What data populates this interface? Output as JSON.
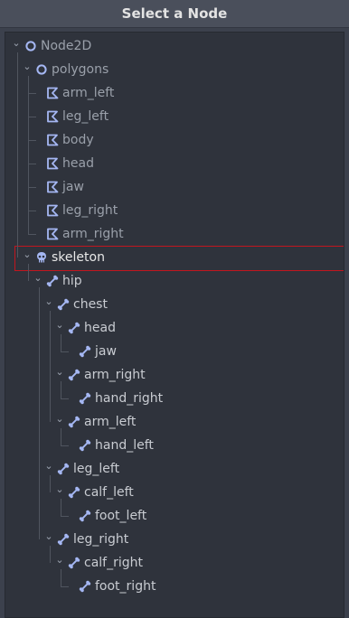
{
  "dialog": {
    "title": "Select a Node"
  },
  "tree": [
    {
      "label": "Node2D",
      "icon": "node2d-icon",
      "depth": 0,
      "expanded": true,
      "dim": true
    },
    {
      "label": "polygons",
      "icon": "node2d-icon",
      "depth": 1,
      "expanded": true,
      "dim": true
    },
    {
      "label": "arm_left",
      "icon": "polygon2d-icon",
      "depth": 2,
      "dim": true
    },
    {
      "label": "leg_left",
      "icon": "polygon2d-icon",
      "depth": 2,
      "dim": true
    },
    {
      "label": "body",
      "icon": "polygon2d-icon",
      "depth": 2,
      "dim": true
    },
    {
      "label": "head",
      "icon": "polygon2d-icon",
      "depth": 2,
      "dim": true
    },
    {
      "label": "jaw",
      "icon": "polygon2d-icon",
      "depth": 2,
      "dim": true
    },
    {
      "label": "leg_right",
      "icon": "polygon2d-icon",
      "depth": 2,
      "dim": true
    },
    {
      "label": "arm_right",
      "icon": "polygon2d-icon",
      "depth": 2,
      "dim": true
    },
    {
      "label": "skeleton",
      "icon": "skeleton-icon",
      "depth": 1,
      "expanded": true,
      "selected": true
    },
    {
      "label": "hip",
      "icon": "bone-icon",
      "depth": 2,
      "expanded": true
    },
    {
      "label": "chest",
      "icon": "bone-icon",
      "depth": 3,
      "expanded": true
    },
    {
      "label": "head",
      "icon": "bone-icon",
      "depth": 4,
      "expanded": true
    },
    {
      "label": "jaw",
      "icon": "bone-icon",
      "depth": 5
    },
    {
      "label": "arm_right",
      "icon": "bone-icon",
      "depth": 4,
      "expanded": true
    },
    {
      "label": "hand_right",
      "icon": "bone-icon",
      "depth": 5
    },
    {
      "label": "arm_left",
      "icon": "bone-icon",
      "depth": 4,
      "expanded": true
    },
    {
      "label": "hand_left",
      "icon": "bone-icon",
      "depth": 5
    },
    {
      "label": "leg_left",
      "icon": "bone-icon",
      "depth": 3,
      "expanded": true
    },
    {
      "label": "calf_left",
      "icon": "bone-icon",
      "depth": 4,
      "expanded": true
    },
    {
      "label": "foot_left",
      "icon": "bone-icon",
      "depth": 5
    },
    {
      "label": "leg_right",
      "icon": "bone-icon",
      "depth": 3,
      "expanded": true
    },
    {
      "label": "calf_right",
      "icon": "bone-icon",
      "depth": 4,
      "expanded": true
    },
    {
      "label": "foot_right",
      "icon": "bone-icon",
      "depth": 5
    }
  ],
  "colors": {
    "accent_icon": "#a5b7f3",
    "selection_border": "#c2161f"
  }
}
